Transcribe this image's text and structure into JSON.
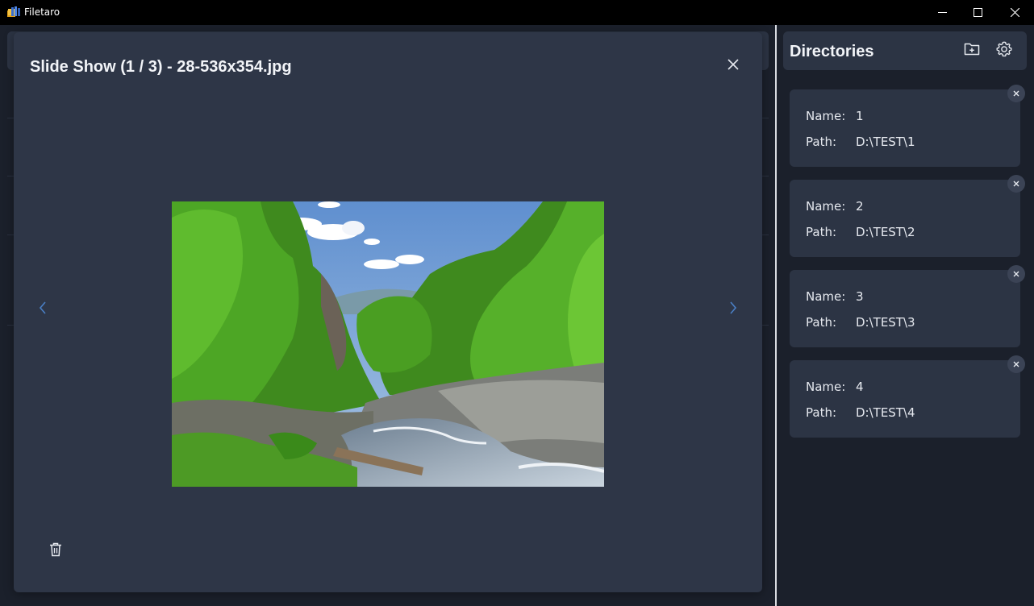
{
  "app": {
    "title": "Filetaro"
  },
  "slideshow": {
    "title": "Slide Show (1 / 3) - 28-536x354.jpg"
  },
  "directories": {
    "title": "Directories",
    "name_label": "Name:",
    "path_label": "Path:",
    "items": [
      {
        "name": "1",
        "path": "D:\\TEST\\1"
      },
      {
        "name": "2",
        "path": "D:\\TEST\\2"
      },
      {
        "name": "3",
        "path": "D:\\TEST\\3"
      },
      {
        "name": "4",
        "path": "D:\\TEST\\4"
      }
    ]
  },
  "icons": {
    "app": "app-icon",
    "minimize": "minimize-icon",
    "maximize": "maximize-icon",
    "close": "close-icon",
    "prev": "chevron-left-icon",
    "next": "chevron-right-icon",
    "delete": "trash-icon",
    "add_folder": "folder-plus-icon",
    "settings": "gear-icon"
  },
  "colors": {
    "background": "#1b202b",
    "panel": "#2c3444",
    "modal": "#2e3647",
    "accent": "#4a7fc4",
    "text": "#e6e9ef"
  }
}
